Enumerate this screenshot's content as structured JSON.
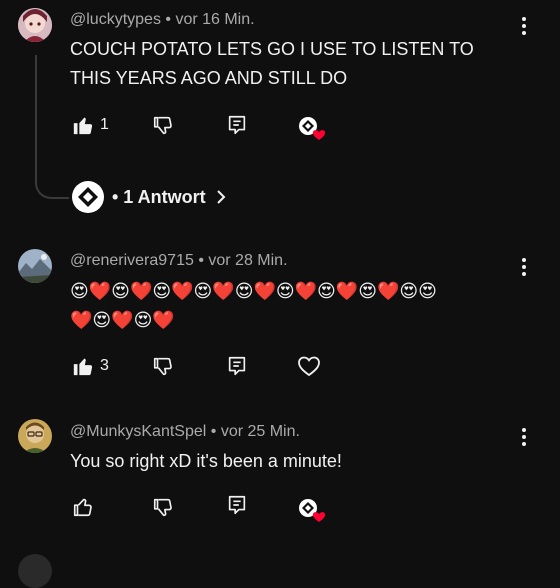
{
  "comments": [
    {
      "author": "@luckytypes",
      "time": "vor 16 Min.",
      "text_lines": [
        "COUCH POTATO LETS GO I USE TO LISTEN TO",
        "THIS YEARS AGO AND STILL DO"
      ],
      "likes": "1",
      "liked": true,
      "creator_hearted": true,
      "replies_label": "• 1 Antwort",
      "avatar_icon": "anime-avatar"
    },
    {
      "author": "@renerivera9715",
      "time": "vor 28 Min.",
      "text_lines": [
        "😍❤️😍❤️😍❤️😍❤️😍❤️😍❤️😍❤️😍❤️😍😍",
        "❤️😍❤️😍❤️"
      ],
      "likes": "3",
      "liked": true,
      "creator_hearted": false,
      "avatar_icon": "landscape-avatar"
    },
    {
      "author": "@MunkysKantSpel",
      "time": "vor 25 Min.",
      "text_lines": [
        "You so right xD it's been a minute!"
      ],
      "likes": "",
      "liked": false,
      "creator_hearted": true,
      "avatar_icon": "person-avatar"
    }
  ],
  "colors": {
    "background": "#0f0f0f",
    "text": "#f1f1f1",
    "meta": "#aaaaaa",
    "heart": "#ff0033"
  }
}
